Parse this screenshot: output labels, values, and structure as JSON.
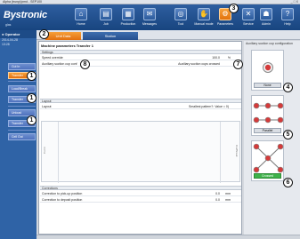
{
  "window": {
    "title": "Alpha (trunp)/pmd - SEP100",
    "controls": "_ □ X"
  },
  "brand": {
    "logo": "Bystronic",
    "sub": "glas"
  },
  "toolbar": [
    {
      "label": "Home",
      "icon": "home-icon"
    },
    {
      "label": "Job",
      "icon": "job-icon"
    },
    {
      "label": "Production",
      "icon": "production-icon"
    },
    {
      "label": "Messages",
      "icon": "messages-icon"
    },
    {
      "label": "Tool",
      "icon": "tool-icon"
    },
    {
      "label": "Manual mode",
      "icon": "manual-mode-icon"
    },
    {
      "label": "Parameters",
      "icon": "parameters-icon"
    },
    {
      "label": "Service",
      "icon": "service-icon"
    },
    {
      "label": "Admin",
      "icon": "admin-icon"
    },
    {
      "label": "Help",
      "icon": "help-icon"
    }
  ],
  "operator": {
    "label": "Operator",
    "date": "2014-04-28",
    "time": "13:28"
  },
  "tabs": [
    {
      "label": "Unit Data"
    },
    {
      "label": "Station"
    }
  ],
  "nav": [
    {
      "label": "Cut In"
    },
    {
      "label": "Transfer"
    },
    {
      "label": "Load/Break"
    },
    {
      "label": "Transfer"
    },
    {
      "label": "Unload"
    },
    {
      "label": "Transfer"
    },
    {
      "label": "Cell Out"
    }
  ],
  "main": {
    "title": "Machine parameters Transfer 1",
    "settings_header": "Settings",
    "speed_label": "Speed override",
    "speed_value": "100.0",
    "speed_unit": "%",
    "suction_label": "Auxiliary suction cup conf",
    "suction_value": "Auxiliary suction cups crossed",
    "layout_header": "Layout",
    "layout_label": "Layout",
    "layout_value": "Smallest pattern?: Value = 0)",
    "layout_left": "Cut In",
    "layout_right": "Cut/Break",
    "corrections_header": "Corrections",
    "pickup_label": "Correction to pick-up position",
    "pickup_value": "0.0",
    "pickup_unit": "mm",
    "deposit_label": "Correction to deposit position",
    "deposit_value": "0.0",
    "deposit_unit": "mm"
  },
  "right": {
    "title": "Auxiliary suction cup configuration",
    "options": [
      {
        "label": "None"
      },
      {
        "label": "Parallel"
      },
      {
        "label": "Crossed"
      }
    ]
  },
  "callouts": [
    "1",
    "1",
    "1",
    "2",
    "3",
    "4",
    "5",
    "6",
    "7",
    "8"
  ],
  "colors": {
    "accent": "#f08a1c",
    "nav_blue": "#2f63a6",
    "header_blue": "#1d4b87",
    "selected_green": "#3fb24a",
    "cup_red": "#d43a3a"
  }
}
